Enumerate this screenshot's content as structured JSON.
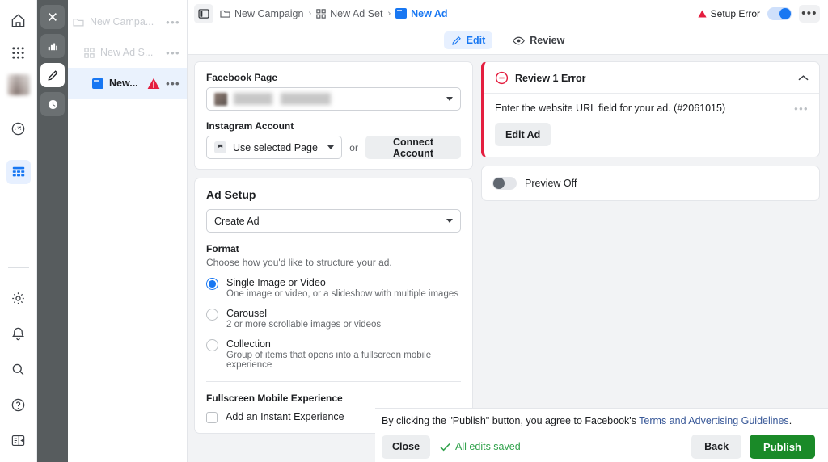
{
  "rail": {
    "top": [
      {
        "name": "home-icon",
        "label": "Home"
      },
      {
        "name": "apps-grid-icon",
        "label": "All Tools"
      },
      {
        "name": "avatar",
        "label": "Account"
      },
      {
        "name": "speedometer-icon",
        "label": "Performance"
      },
      {
        "name": "table-icon",
        "label": "Ads Manager",
        "active": true
      }
    ],
    "bottom": [
      {
        "name": "gear-icon",
        "label": "Settings"
      },
      {
        "name": "bell-icon",
        "label": "Notifications"
      },
      {
        "name": "search-icon",
        "label": "Search"
      },
      {
        "name": "help-icon",
        "label": "Help"
      },
      {
        "name": "panel-toggle-icon",
        "label": "Toggle Panel"
      }
    ]
  },
  "toolstrip": [
    {
      "name": "close-icon",
      "label": "Close",
      "selected": false
    },
    {
      "name": "chart-bar-icon",
      "label": "Charts",
      "selected": false
    },
    {
      "name": "pencil-icon",
      "label": "Edit",
      "selected": true
    },
    {
      "name": "clock-icon",
      "label": "History",
      "selected": false
    }
  ],
  "tree": {
    "items": [
      {
        "label": "New Campa...",
        "icon": "folder-icon",
        "level": 1,
        "selected": false,
        "warning": false
      },
      {
        "label": "New Ad S...",
        "icon": "adset-grid-icon",
        "level": 2,
        "selected": false,
        "warning": false
      },
      {
        "label": "New...",
        "icon": "ad-square-icon",
        "level": 3,
        "selected": true,
        "warning": true
      }
    ],
    "menu_glyph": "•••"
  },
  "topbar": {
    "panel_icon": "side-panel-icon",
    "breadcrumb": [
      {
        "label": "New Campaign",
        "icon": "folder-icon",
        "active": false
      },
      {
        "label": "New Ad Set",
        "icon": "adset-grid-icon",
        "active": false
      },
      {
        "label": "New Ad",
        "icon": "ad-square-icon",
        "active": true
      }
    ],
    "separator": "›",
    "setup_error_label": "Setup Error",
    "toggle_state": "on",
    "kebab_glyph": "•••"
  },
  "tabs": [
    {
      "label": "Edit",
      "icon": "pencil-icon",
      "active": true
    },
    {
      "label": "Review",
      "icon": "eye-icon",
      "active": false
    }
  ],
  "identity": {
    "facebook_page_label": "Facebook Page",
    "facebook_page_value": "",
    "instagram_label": "Instagram Account",
    "instagram_value": "Use selected Page",
    "or_text": "or",
    "connect_account_label": "Connect Account"
  },
  "ad_setup": {
    "title": "Ad Setup",
    "create_ad_value": "Create Ad",
    "format_label": "Format",
    "format_hint": "Choose how you'd like to structure your ad.",
    "options": [
      {
        "title": "Single Image or Video",
        "desc": "One image or video, or a slideshow with multiple images",
        "selected": true
      },
      {
        "title": "Carousel",
        "desc": "2 or more scrollable images or videos",
        "selected": false
      },
      {
        "title": "Collection",
        "desc": "Group of items that opens into a fullscreen mobile experience",
        "selected": false
      }
    ],
    "fullscreen_label": "Fullscreen Mobile Experience",
    "instant_experience_label": "Add an Instant Experience"
  },
  "error_panel": {
    "title": "Review 1 Error",
    "message": "Enter the website URL field for your ad. (#2061015)",
    "edit_ad_label": "Edit Ad",
    "kebab_glyph": "•••",
    "accent_color": "#e41e3f"
  },
  "preview": {
    "label": "Preview Off",
    "state": "off"
  },
  "footer": {
    "terms_prefix": "By clicking the \"Publish\" button, you agree to Facebook's ",
    "terms_link": "Terms and Advertising Guidelines",
    "terms_suffix": ".",
    "close_label": "Close",
    "saved_label": "All edits saved",
    "saved_color": "#31a24c",
    "back_label": "Back",
    "publish_label": "Publish",
    "publish_color": "#1a8a28"
  }
}
